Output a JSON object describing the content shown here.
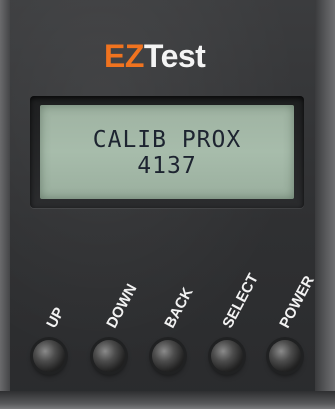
{
  "brand": {
    "prefix": "EZ",
    "suffix": "Test",
    "prefix_color": "#f0731f",
    "suffix_color": "#f4f4f4"
  },
  "display": {
    "line1": "CALIB PROX",
    "line2": "4137",
    "background_color": "#a7bcab",
    "text_color": "#1d2430"
  },
  "buttons": [
    {
      "label": "UP"
    },
    {
      "label": "DOWN"
    },
    {
      "label": "BACK"
    },
    {
      "label": "SELECT"
    },
    {
      "label": "POWER"
    }
  ]
}
